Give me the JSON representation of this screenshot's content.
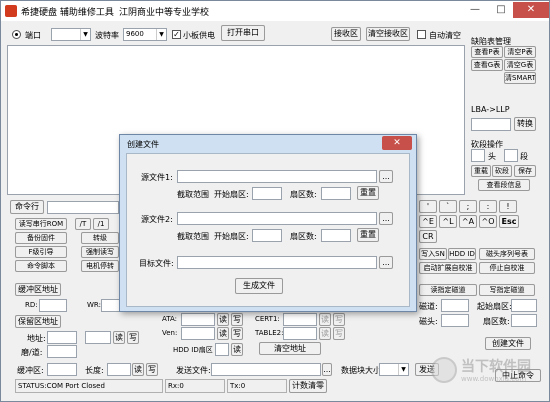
{
  "window": {
    "title": "希捷硬盘 辅助维修工具",
    "subtitle": "江阴商业中等专业学校",
    "min_glyph": "—",
    "max_glyph": "□",
    "close_glyph": "✕"
  },
  "top": {
    "port_label": "端口",
    "port_value": "",
    "baud_label": "波特率",
    "baud_value": "9600",
    "board_power_label": "小板供电",
    "board_power_checked": "✓",
    "open_port": "打开串口",
    "receive_area": "接收区",
    "clear_receive": "清空接收区",
    "auto_clear_label": "自动清空"
  },
  "defects": {
    "title": "缺陷表管理",
    "buttons": [
      "查看P表",
      "清空P表",
      "查看G表",
      "清空G表",
      "清SMART"
    ]
  },
  "lba": {
    "label": "LBA->LLP",
    "convert": "转换"
  },
  "segment": {
    "title": "砍段操作",
    "head_label": "头",
    "seg_label": "段",
    "buttons": [
      "重载",
      "砍段",
      "保存"
    ],
    "view_info": "查看段信息"
  },
  "cmd": {
    "label": "命令行",
    "left_buttons": [
      "读写串行ROM",
      "备份固件",
      "F级引导",
      "命令脚本"
    ],
    "mid_buttons": [
      "/T",
      "/1",
      "转级",
      "强制读写",
      "电机停转"
    ]
  },
  "keys": {
    "row1": [
      "'",
      "`",
      ";",
      ":",
      "!"
    ],
    "row2": [
      "^E",
      "^L",
      "^A",
      "^O",
      "Esc"
    ],
    "row3": [
      "CR"
    ]
  },
  "right_buttons": {
    "write_sn": "写入SN",
    "hdd_id": "HDD ID",
    "head_sn_table": "磁头序列号表",
    "auto_ext_adapt": "启动扩展自校准",
    "stop_adapt": "停止自校准",
    "read_track": "读指定磁道",
    "write_track": "写指定磁道",
    "track_label": "磁道:",
    "start_sector_label": "起始扇区:",
    "head_label": "磁头:",
    "sector_count_label": "扇区数:",
    "create_file": "创建文件",
    "stop_cmd": "中止命令"
  },
  "buffer": {
    "buffer_addr": "缓冲区地址",
    "rd_label": "RD:",
    "wr_label": "WR:",
    "keep_buffer_addr": "保留区地址",
    "addr_label": "地址:",
    "track_slash_label": "磨/道:",
    "read": "读",
    "write": "写",
    "buffer_label": "缓冲区:",
    "length_label": "长度:"
  },
  "ata": {
    "ata_label": "ATA:",
    "ven_label": "Ven:",
    "hdd_id_sector_label": "HDD ID扇区",
    "cert1_label": "CERT1:",
    "table2_label": "TABLE2:",
    "read": "读",
    "write": "写",
    "clear_addr": "清空地址"
  },
  "send": {
    "send_file_label": "发送文件:",
    "block_size_label": "数据块大小:",
    "send": "发送"
  },
  "status": {
    "port": "STATUS:COM Port Closed",
    "rx": "Rx:0",
    "tx": "Tx:0",
    "clear_count": "计数清零"
  },
  "dialog": {
    "title": "创建文件",
    "close_glyph": "✕",
    "source1_label": "源文件1:",
    "source2_label": "源文件2:",
    "target_label": "目标文件:",
    "range_label": "截取范围",
    "start_sector_label": "开始扇区:",
    "sector_count_label": "扇区数:",
    "reset": "重置",
    "browse": "...",
    "generate": "生成文件"
  },
  "watermark": {
    "text": "当下软件园",
    "sub": "www.downxia.com"
  }
}
